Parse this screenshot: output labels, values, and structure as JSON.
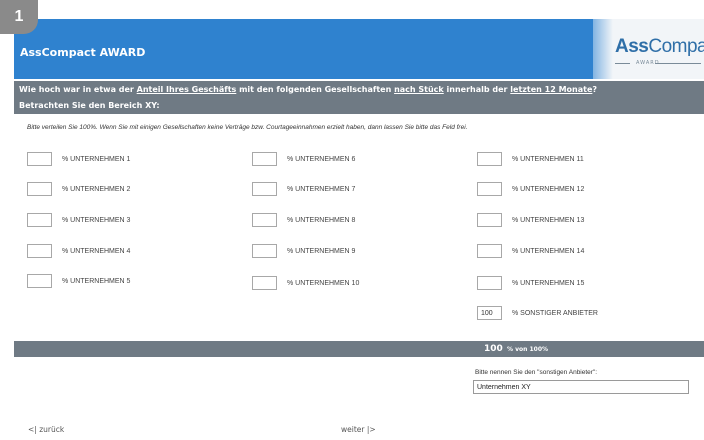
{
  "badge": "1",
  "header": {
    "title": "AssCompact AWARD",
    "logo_bold": "Ass",
    "logo_light": "Compact",
    "logo_sub": "AWARD"
  },
  "question": {
    "seg1": "Wie hoch war in etwa der ",
    "link1": "Anteil Ihres Geschäfts",
    "seg2": " mit den folgenden Gesellschaften ",
    "link2": "nach Stück",
    "seg3": " innerhalb der ",
    "link3": "letzten 12 Monate",
    "seg4": "?"
  },
  "subquestion": "Betrachten Sie den Bereich XY:",
  "instruction": "Bitte verteilen Sie 100%. Wenn Sie mit einigen Gesellschaften keine Verträge bzw. Courtageeinnahmen erzielt haben, dann lassen Sie bitte das Feld frei.",
  "companies": {
    "c1": {
      "label": "% UNTERNEHMEN 1",
      "value": ""
    },
    "c2": {
      "label": "% UNTERNEHMEN 2",
      "value": ""
    },
    "c3": {
      "label": "% UNTERNEHMEN 3",
      "value": ""
    },
    "c4": {
      "label": "% UNTERNEHMEN 4",
      "value": ""
    },
    "c5": {
      "label": "% UNTERNEHMEN 5",
      "value": ""
    },
    "c6": {
      "label": "% UNTERNEHMEN 6",
      "value": ""
    },
    "c7": {
      "label": "% UNTERNEHMEN 7",
      "value": ""
    },
    "c8": {
      "label": "% UNTERNEHMEN 8",
      "value": ""
    },
    "c9": {
      "label": "% UNTERNEHMEN 9",
      "value": ""
    },
    "c10": {
      "label": "% UNTERNEHMEN 10",
      "value": ""
    },
    "c11": {
      "label": "% UNTERNEHMEN 11",
      "value": ""
    },
    "c12": {
      "label": "% UNTERNEHMEN 12",
      "value": ""
    },
    "c13": {
      "label": "% UNTERNEHMEN 13",
      "value": ""
    },
    "c14": {
      "label": "% UNTERNEHMEN 14",
      "value": ""
    },
    "c15": {
      "label": "% UNTERNEHMEN 15",
      "value": ""
    },
    "other": {
      "label": "% SONSTIGER ANBIETER",
      "value": "100"
    }
  },
  "sum": {
    "value": "100",
    "unit": "% von 100%"
  },
  "other_provider": {
    "label": "Bitte nennen Sie den \"sonstigen Anbieter\":",
    "value": "Unternehmen XY"
  },
  "nav": {
    "back": "<| zurück",
    "next": "weiter |>"
  },
  "colors": {
    "header_blue": "#2f82cf",
    "bar_grey": "#6f7a84",
    "logo_blue": "#2f6fa8"
  }
}
